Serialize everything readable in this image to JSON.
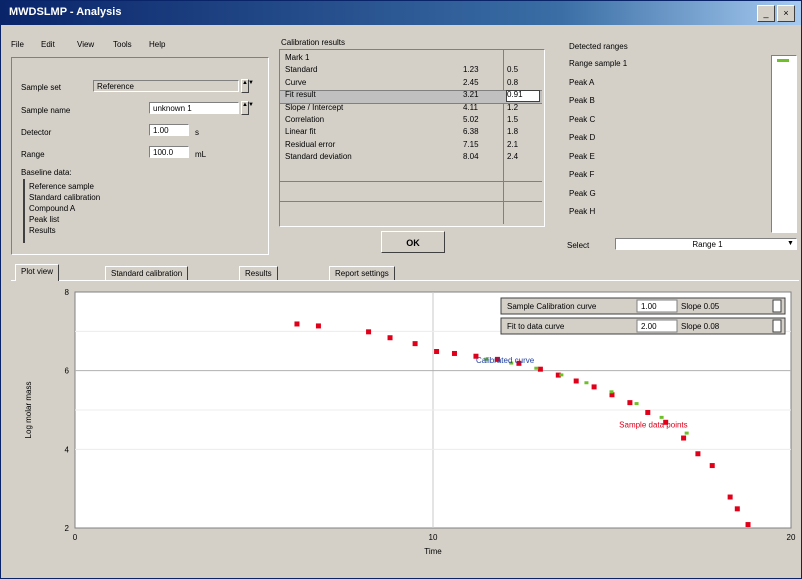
{
  "window": {
    "title": "MWDSLMP - Analysis"
  },
  "menu": [
    "File",
    "Edit",
    "View",
    "Tools",
    "Help"
  ],
  "left_panel": {
    "rows": [
      {
        "label": "Sample set",
        "value": "Reference"
      },
      {
        "label": "Sample name",
        "value": "unknown 1"
      },
      {
        "label": "Detector",
        "value": "1.00",
        "unit": "s"
      },
      {
        "label": "Range",
        "value": "100.0",
        "unit": "mL"
      }
    ],
    "list_label": "Baseline data:",
    "list_items": [
      "Reference sample",
      "Standard calibration",
      "Compound A",
      "Peak list",
      "Results"
    ]
  },
  "table": {
    "title": "Calibration results",
    "rows": [
      [
        "Mark 1",
        "",
        ""
      ],
      [
        "Standard",
        "1.23",
        "0.5"
      ],
      [
        "Curve",
        "2.45",
        "0.8"
      ],
      [
        "Fit result",
        "3.21",
        "0.91"
      ],
      [
        "Slope / Intercept",
        "4.11",
        "1.2"
      ],
      [
        "Correlation",
        "5.02",
        "1.5"
      ],
      [
        "Linear fit",
        "6.38",
        "1.8"
      ],
      [
        "Residual error",
        "7.15",
        "2.1"
      ],
      [
        "Standard deviation",
        "8.04",
        "2.4"
      ]
    ]
  },
  "ok_button": "OK",
  "right_panel": {
    "header": "Detected ranges",
    "items": [
      "Range sample 1",
      "Peak A",
      "Peak B",
      "Peak C",
      "Peak D",
      "Peak E",
      "Peak F",
      "Peak G",
      "Peak H"
    ],
    "dropdown_label": "Select",
    "dropdown_value": "Range 1"
  },
  "tabs": [
    "Plot view",
    "Standard calibration",
    "Results",
    "Report settings"
  ],
  "legend": [
    {
      "label": "Sample Calibration curve",
      "value": "1.00",
      "extra": "Slope 0.05"
    },
    {
      "label": "Fit to data curve",
      "value": "2.00",
      "extra": "Slope 0.08"
    }
  ],
  "annotations": {
    "blue": "Calibrated curve",
    "red": "Sample data points"
  },
  "chart_data": {
    "type": "scatter",
    "xlabel": "Time",
    "ylabel": "Log molar mass",
    "xlim": [
      0,
      20
    ],
    "ylim": [
      2,
      8
    ],
    "yticks": [
      "8",
      "6",
      "4",
      "2"
    ],
    "xticks": [
      "0",
      "10",
      "20"
    ],
    "grid": true,
    "series": [
      {
        "name": "Sample data points",
        "color": "#e0001a",
        "points": [
          [
            6.2,
            7.2
          ],
          [
            6.8,
            7.15
          ],
          [
            8.2,
            7.0
          ],
          [
            8.8,
            6.85
          ],
          [
            9.5,
            6.7
          ],
          [
            10.1,
            6.5
          ],
          [
            10.6,
            6.45
          ],
          [
            11.2,
            6.38
          ],
          [
            11.8,
            6.3
          ],
          [
            12.4,
            6.2
          ],
          [
            13.0,
            6.05
          ],
          [
            13.5,
            5.9
          ],
          [
            14.0,
            5.75
          ],
          [
            14.5,
            5.6
          ],
          [
            15.0,
            5.4
          ],
          [
            15.5,
            5.2
          ],
          [
            16.0,
            4.95
          ],
          [
            16.5,
            4.7
          ],
          [
            17.0,
            4.3
          ],
          [
            17.4,
            3.9
          ],
          [
            17.8,
            3.6
          ],
          [
            18.3,
            2.8
          ],
          [
            18.5,
            2.5
          ],
          [
            18.8,
            2.1
          ]
        ]
      },
      {
        "name": "Calibrated curve",
        "color": "#6fbf2a",
        "points": [
          [
            11.5,
            6.28
          ],
          [
            12.2,
            6.18
          ],
          [
            12.9,
            6.05
          ],
          [
            13.6,
            5.88
          ],
          [
            14.3,
            5.68
          ],
          [
            15.0,
            5.45
          ],
          [
            15.7,
            5.15
          ],
          [
            16.4,
            4.8
          ],
          [
            17.1,
            4.4
          ]
        ]
      }
    ]
  }
}
